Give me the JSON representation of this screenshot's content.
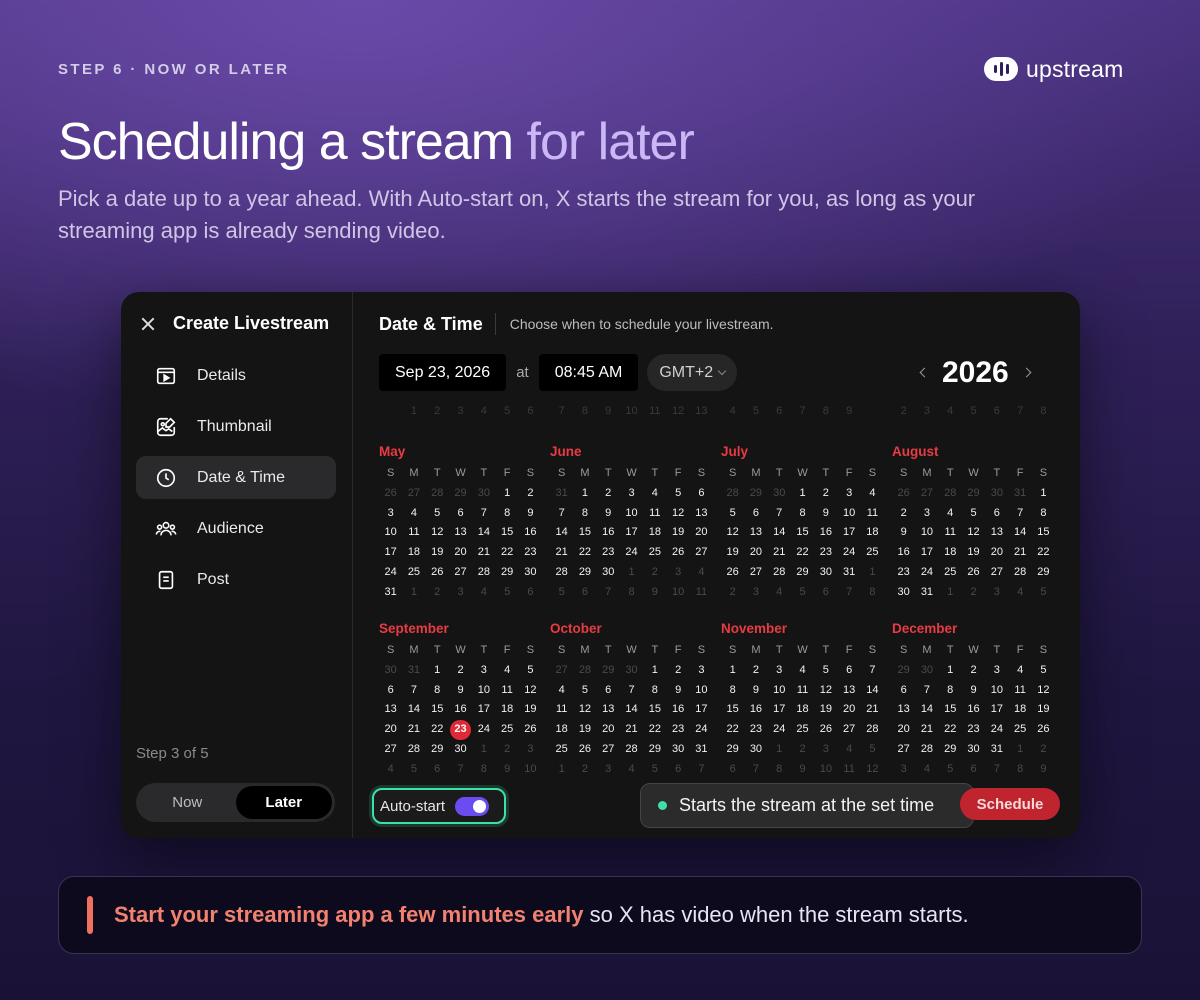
{
  "header": {
    "step_label": "STEP 6 · NOW OR LATER",
    "brand": "upstream",
    "headline_main": "Scheduling a stream",
    "headline_accent": "for later",
    "subtitle": "Pick a date up to a year ahead. With Auto-start on, X starts the stream for you, as long as your streaming app is already sending video."
  },
  "sidebar": {
    "title": "Create Livestream",
    "items": [
      {
        "label": "Details",
        "icon": "video-play-icon",
        "active": false
      },
      {
        "label": "Thumbnail",
        "icon": "image-edit-icon",
        "active": false
      },
      {
        "label": "Date & Time",
        "icon": "clock-icon",
        "active": true
      },
      {
        "label": "Audience",
        "icon": "people-icon",
        "active": false
      },
      {
        "label": "Post",
        "icon": "document-icon",
        "active": false
      }
    ],
    "step_count": "Step 3 of 5",
    "toggle": {
      "now": "Now",
      "later": "Later",
      "selected": "later"
    }
  },
  "main": {
    "title": "Date & Time",
    "description": "Choose when to schedule your livestream.",
    "date_value": "Sep 23, 2026",
    "at_label": "at",
    "time_value": "08:45 AM",
    "timezone": "GMT+2",
    "year": "2026",
    "auto_start_label": "Auto-start",
    "auto_start_on": true,
    "tip_text": "Starts the stream at the set time",
    "schedule_label": "Schedule"
  },
  "calendar": {
    "weekdays": [
      "S",
      "M",
      "T",
      "W",
      "T",
      "F",
      "S"
    ],
    "months": [
      {
        "name": "May",
        "start": 5,
        "days": 31,
        "prev_days": 30
      },
      {
        "name": "June",
        "start": 1,
        "days": 30,
        "prev_days": 31
      },
      {
        "name": "July",
        "start": 3,
        "days": 31,
        "prev_days": 30
      },
      {
        "name": "August",
        "start": 6,
        "days": 31,
        "prev_days": 31
      },
      {
        "name": "September",
        "start": 2,
        "days": 30,
        "prev_days": 31,
        "selected": 23
      },
      {
        "name": "October",
        "start": 4,
        "days": 31,
        "prev_days": 30
      },
      {
        "name": "November",
        "start": 0,
        "days": 30,
        "prev_days": 31
      },
      {
        "name": "December",
        "start": 2,
        "days": 31,
        "prev_days": 30
      }
    ]
  },
  "callout": {
    "highlight": "Start your streaming app a few minutes early",
    "rest": " so X has video when the stream starts."
  },
  "colors": {
    "accent_red": "#e02a36",
    "accent_green": "#3ee0a8",
    "toggle_purple": "#6a4cf0",
    "callout_coral": "#f2826f"
  }
}
